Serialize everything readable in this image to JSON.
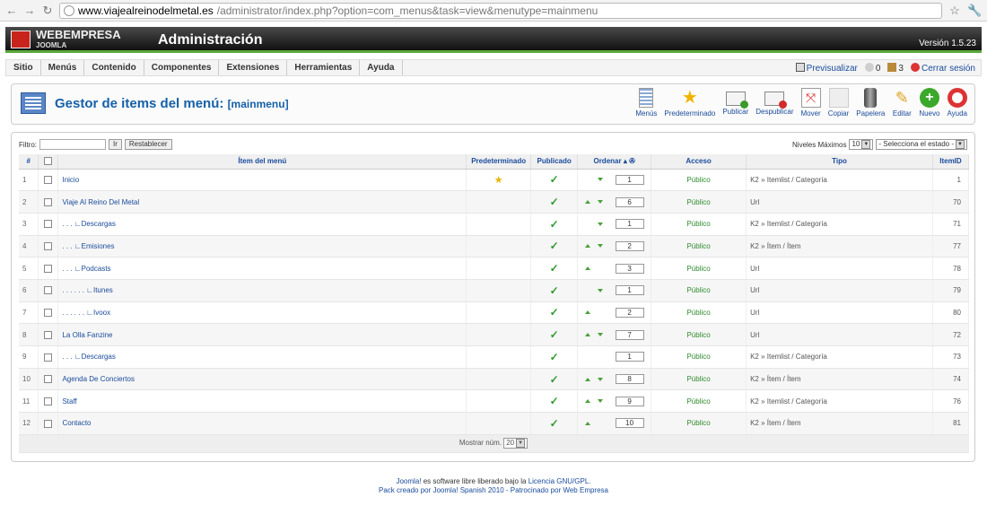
{
  "browser": {
    "url_domain": "www.viajealreinodelmetal.es",
    "url_path": "/administrator/index.php?option=com_menus&task=view&menutype=mainmenu"
  },
  "header": {
    "logo_text": "WEBEMPRESA",
    "logo_sub": "JOOMLA",
    "title": "Administración",
    "version": "Versión 1.5.23"
  },
  "menubar": {
    "items": [
      "Sitio",
      "Menús",
      "Contenido",
      "Componentes",
      "Extensiones",
      "Herramientas",
      "Ayuda"
    ],
    "preview": "Previsualizar",
    "messages_count": "0",
    "users_count": "3",
    "logout": "Cerrar sesión"
  },
  "toolbar": {
    "title": "Gestor de items del menú:",
    "subtitle": "[mainmenu]",
    "buttons": [
      {
        "label": "Menús",
        "icon": "menus-icon"
      },
      {
        "label": "Predeterminado",
        "icon": "star-icon"
      },
      {
        "label": "Publicar",
        "icon": "publish-icon"
      },
      {
        "label": "Despublicar",
        "icon": "unpublish-icon"
      },
      {
        "label": "Mover",
        "icon": "move-icon"
      },
      {
        "label": "Copiar",
        "icon": "copy-icon"
      },
      {
        "label": "Papelera",
        "icon": "trash-icon"
      },
      {
        "label": "Editar",
        "icon": "edit-icon"
      },
      {
        "label": "Nuevo",
        "icon": "new-icon"
      },
      {
        "label": "Ayuda",
        "icon": "help-icon"
      }
    ]
  },
  "filter": {
    "label": "Filtro:",
    "go": "Ir",
    "reset": "Restablecer",
    "levels_label": "Niveles Máximos",
    "levels_value": "10",
    "state_value": "- Selecciona el estado -"
  },
  "table": {
    "headers": [
      "#",
      "",
      "Ítem del menú",
      "Predeterminado",
      "Publicado",
      "Ordenar",
      "Acceso",
      "Tipo",
      "ItemID"
    ],
    "rows": [
      {
        "n": "1",
        "name": "Inicio",
        "default": true,
        "up": false,
        "down": true,
        "order": "1",
        "access": "Público",
        "type": "K2 » Itemlist / Categoría",
        "id": "1"
      },
      {
        "n": "2",
        "name": "Viaje Al Reino Del Metal",
        "default": false,
        "up": true,
        "down": true,
        "order": "6",
        "access": "Público",
        "type": "Url",
        "id": "70"
      },
      {
        "n": "3",
        "name": ". . . ∟Descargas",
        "default": false,
        "up": false,
        "down": true,
        "order": "1",
        "access": "Público",
        "type": "K2 » Itemlist / Categoría",
        "id": "71"
      },
      {
        "n": "4",
        "name": ". . . ∟Emisiones",
        "default": false,
        "up": true,
        "down": true,
        "order": "2",
        "access": "Público",
        "type": "K2 » Ítem / Ítem",
        "id": "77"
      },
      {
        "n": "5",
        "name": ". . . ∟Podcasts",
        "default": false,
        "up": true,
        "down": false,
        "order": "3",
        "access": "Público",
        "type": "Url",
        "id": "78"
      },
      {
        "n": "6",
        "name": ". . . . . . ∟Itunes",
        "default": false,
        "up": false,
        "down": true,
        "order": "1",
        "access": "Público",
        "type": "Url",
        "id": "79"
      },
      {
        "n": "7",
        "name": ". . . . . . ∟Ivoox",
        "default": false,
        "up": true,
        "down": false,
        "order": "2",
        "access": "Público",
        "type": "Url",
        "id": "80"
      },
      {
        "n": "8",
        "name": "La Olla Fanzine",
        "default": false,
        "up": true,
        "down": true,
        "order": "7",
        "access": "Público",
        "type": "Url",
        "id": "72"
      },
      {
        "n": "9",
        "name": ". . . ∟Descargas",
        "default": false,
        "up": false,
        "down": false,
        "order": "1",
        "access": "Público",
        "type": "K2 » Itemlist / Categoría",
        "id": "73"
      },
      {
        "n": "10",
        "name": "Agenda De Conciertos",
        "default": false,
        "up": true,
        "down": true,
        "order": "8",
        "access": "Público",
        "type": "K2 » Ítem / Ítem",
        "id": "74"
      },
      {
        "n": "11",
        "name": "Staff",
        "default": false,
        "up": true,
        "down": true,
        "order": "9",
        "access": "Público",
        "type": "K2 » Itemlist / Categoría",
        "id": "76"
      },
      {
        "n": "12",
        "name": "Contacto",
        "default": false,
        "up": true,
        "down": false,
        "order": "10",
        "access": "Público",
        "type": "K2 » Ítem / Ítem",
        "id": "81"
      }
    ],
    "show_label": "Mostrar núm.",
    "show_value": "20"
  },
  "footer": {
    "line1_link": "Joomla!",
    "line1_text": " es software libre liberado bajo la ",
    "line1_license": "Licencia GNU/GPL.",
    "line2": "Pack creado por Joomla! Spanish 2010 - Patrocinado por Web Empresa"
  },
  "colors": {
    "link": "#1a4b9b",
    "accent_green": "#5aa83a",
    "header_dark": "#111111"
  }
}
